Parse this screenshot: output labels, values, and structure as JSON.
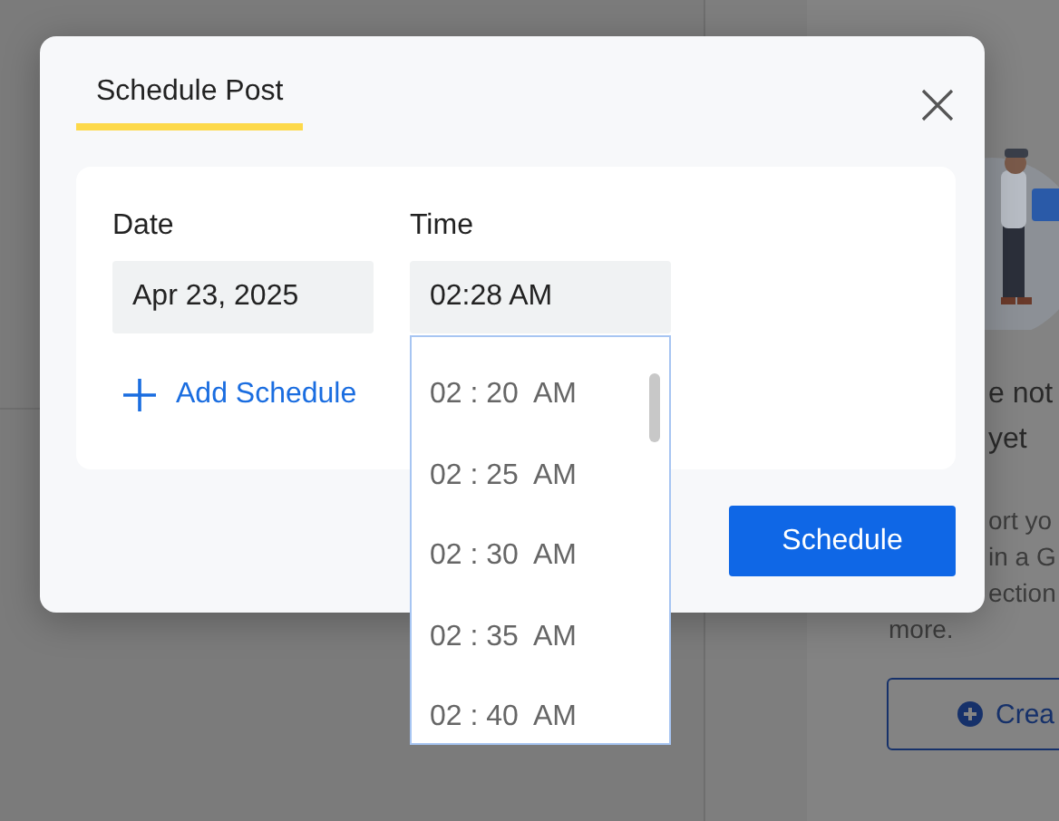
{
  "background": {
    "panel_lines": [
      {
        "text": "e not",
        "kind": "title"
      },
      {
        "text": "yet",
        "kind": "title"
      },
      {
        "text": "ort yo",
        "kind": "body"
      },
      {
        "text": "in a G",
        "kind": "body"
      },
      {
        "text": "ection",
        "kind": "body"
      }
    ],
    "below_lines": [
      "more."
    ],
    "create_button": {
      "label": "Crea"
    }
  },
  "dialog": {
    "tabs": [
      {
        "label": "Schedule Post",
        "selected": true
      }
    ],
    "fields": [
      {
        "label": "Date",
        "value": "Apr 23, 2025",
        "kind": "date"
      },
      {
        "label": "Time",
        "value": "02:28 AM",
        "kind": "time"
      }
    ],
    "add_schedule": "Add Schedule",
    "time_options": [
      "02 : 20  AM",
      "02 : 25  AM",
      "02 : 30  AM",
      "02 : 35  AM",
      "02 : 40  AM"
    ],
    "submit": "Schedule"
  }
}
